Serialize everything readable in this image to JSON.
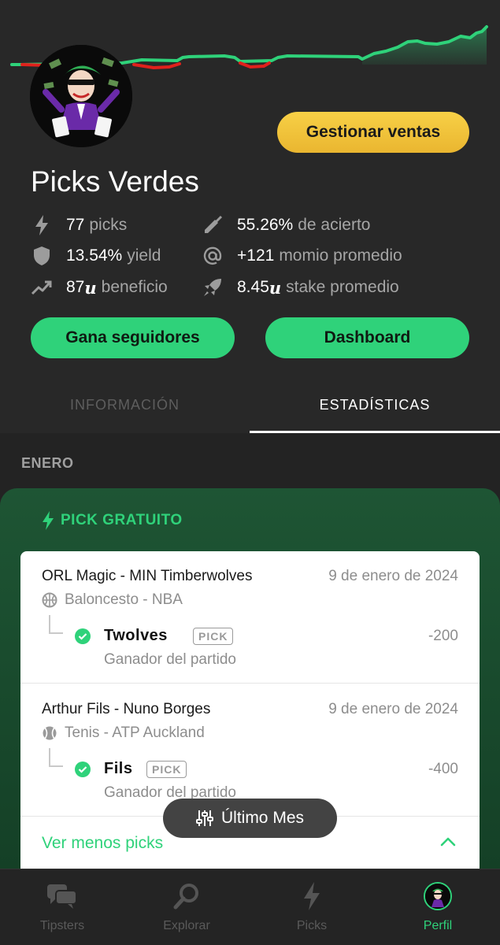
{
  "profile": {
    "name": "Picks Verdes",
    "manage_sales_label": "Gestionar ventas",
    "stats": {
      "picks_value": "77",
      "picks_label": "picks",
      "accuracy_value": "55.26%",
      "accuracy_label": "de acierto",
      "yield_value": "13.54%",
      "yield_label": "yield",
      "momio_value": "+121",
      "momio_label": "momio promedio",
      "profit_value": "87",
      "profit_unit": "u",
      "profit_label": "beneficio",
      "stake_value": "8.45",
      "stake_unit": "u",
      "stake_label": "stake promedio"
    },
    "followers_button": "Gana seguidores",
    "dashboard_button": "Dashboard"
  },
  "tabs": [
    {
      "label": "INFORMACIÓN",
      "active": false
    },
    {
      "label": "ESTADÍSTICAS",
      "active": true
    }
  ],
  "month": "ENERO",
  "free_pick": {
    "title": "PICK GRATUITO",
    "picks": [
      {
        "match": "ORL Magic - MIN Timberwolves",
        "date": "9 de enero de 2024",
        "league": "Baloncesto - NBA",
        "league_icon": "basketball-icon",
        "selection": "Twolves",
        "badge": "PICK",
        "odds": "-200",
        "market": "Ganador del partido"
      },
      {
        "match": "Arthur Fils - Nuno Borges",
        "date": "9 de enero de 2024",
        "league": "Tenis - ATP Auckland",
        "league_icon": "tennis-ball-icon",
        "selection": "Fils",
        "badge": "PICK",
        "odds": "-400",
        "market": "Ganador del partido"
      }
    ],
    "show_less": "Ver menos picks"
  },
  "filter": {
    "label": "Último Mes",
    "icon": "sliders-icon"
  },
  "nav": [
    {
      "label": "Tipsters",
      "icon": "chat-bubbles-icon",
      "active": false
    },
    {
      "label": "Explorar",
      "icon": "search-icon",
      "active": false
    },
    {
      "label": "Picks",
      "icon": "bolt-icon",
      "active": false
    },
    {
      "label": "Perfil",
      "icon": "avatar",
      "active": true
    }
  ],
  "colors": {
    "accent": "#2fd27a",
    "gold": "#f2c744",
    "loss": "#e0211c",
    "background": "#282828"
  }
}
